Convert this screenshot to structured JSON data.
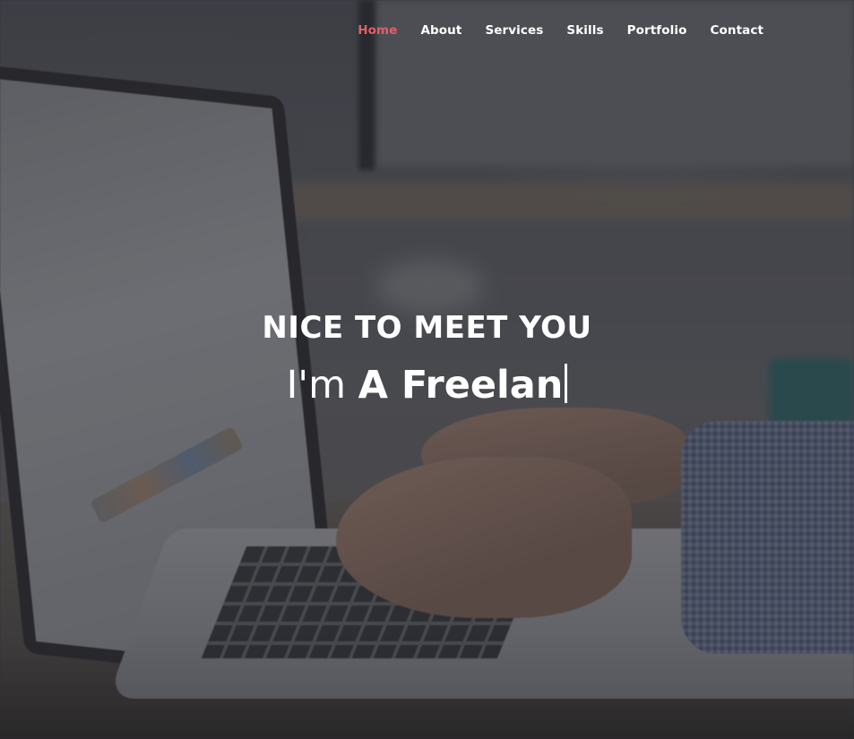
{
  "nav": {
    "items": [
      {
        "label": "Home",
        "active": true
      },
      {
        "label": "About",
        "active": false
      },
      {
        "label": "Services",
        "active": false
      },
      {
        "label": "Skills",
        "active": false
      },
      {
        "label": "Portfolio",
        "active": false
      },
      {
        "label": "Contact",
        "active": false
      }
    ],
    "active_color": "#e0606a",
    "text_color": "#ffffff"
  },
  "hero": {
    "greeting": "NICE TO MEET YOU",
    "intro_prefix": "I'm",
    "typed_text": "A Freelan"
  },
  "background": {
    "description_icon": "laptop-typing-photo"
  }
}
